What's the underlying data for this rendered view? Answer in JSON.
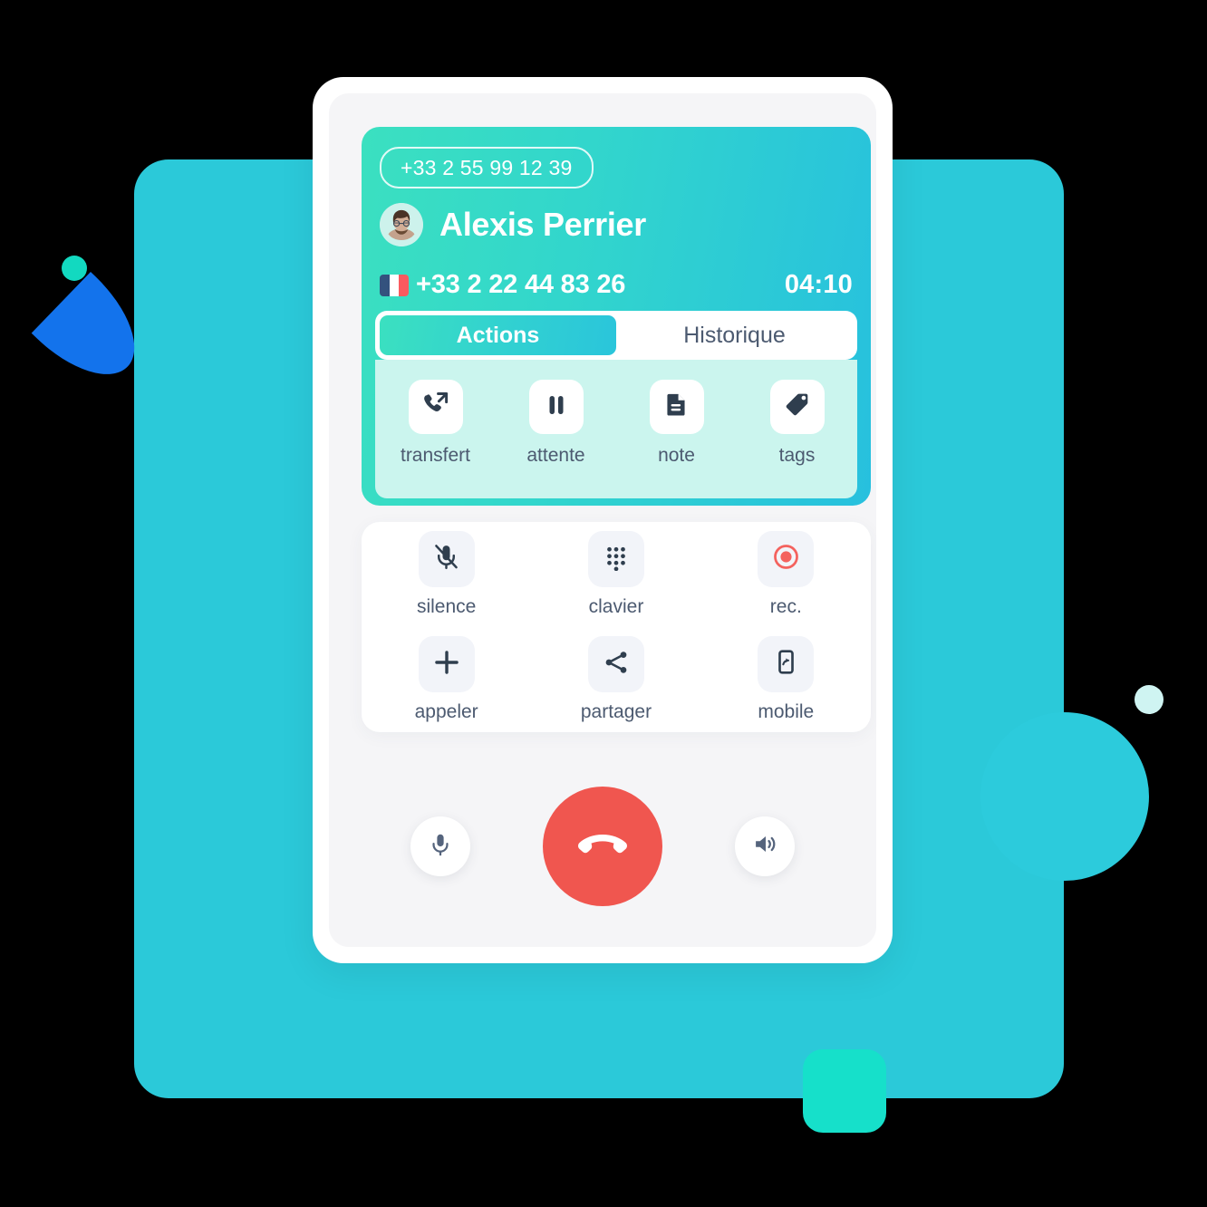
{
  "background": {
    "canvas_color": "#000000",
    "panel_color": "#2BC9D9",
    "accent_blue": "#1373EC",
    "accent_green": "#16E0CA",
    "accent_mint": "#CFF4F2"
  },
  "call": {
    "did_number": "+33 2 55 99 12 39",
    "contact_name": "Alexis Perrier",
    "caller_number": "+33 2 22 44 83 26",
    "timer": "04:10",
    "country_flag": "france-flag-icon",
    "avatar": "contact-avatar",
    "gradient_start": "#3BE0C0",
    "gradient_end": "#27C0DE"
  },
  "tabs": [
    {
      "label": "Actions",
      "icon": "",
      "active": true
    },
    {
      "label": "Historique",
      "icon": "",
      "active": false
    }
  ],
  "actions": [
    {
      "label": "transfert",
      "icon": "call-transfer-icon"
    },
    {
      "label": "attente",
      "icon": "pause-icon"
    },
    {
      "label": "note",
      "icon": "document-note-icon"
    },
    {
      "label": "tags",
      "icon": "tag-icon"
    }
  ],
  "controls": [
    {
      "label": "silence",
      "icon": "microphone-muted-icon"
    },
    {
      "label": "clavier",
      "icon": "dialpad-icon"
    },
    {
      "label": "rec.",
      "icon": "record-icon",
      "color": "#F4625E"
    },
    {
      "label": "appeler",
      "icon": "plus-icon"
    },
    {
      "label": "partager",
      "icon": "share-icon"
    },
    {
      "label": "mobile",
      "icon": "mobile-transfer-icon"
    }
  ],
  "bottom_bar": {
    "mic_icon": "microphone-icon",
    "hangup_icon": "hangup-phone-icon",
    "speaker_icon": "speaker-icon",
    "hangup_color": "#F0564F"
  }
}
